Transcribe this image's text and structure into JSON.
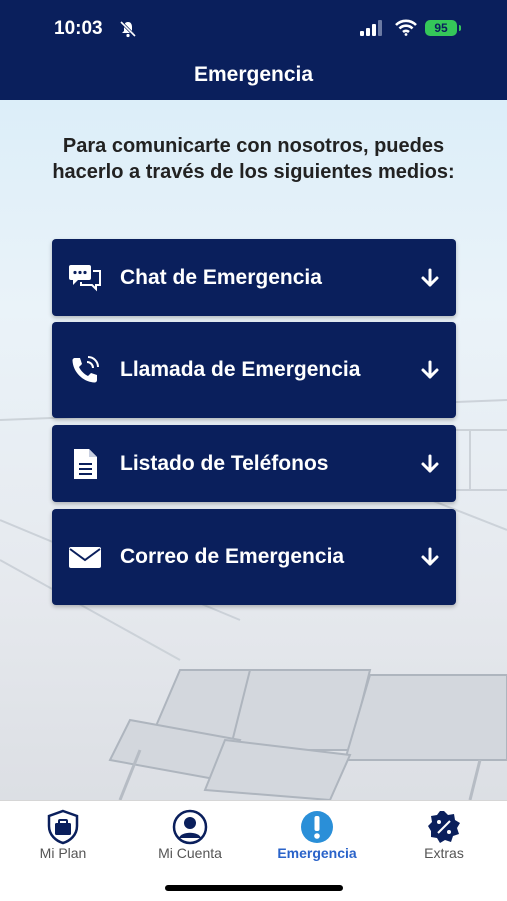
{
  "status_bar": {
    "time": "10:03",
    "battery": "95"
  },
  "header": {
    "title": "Emergencia"
  },
  "intro_text": "Para comunicarte con nosotros, puedes hacerlo a través de los siguientes medios:",
  "options": [
    {
      "label": "Chat de Emergencia",
      "icon": "chat-icon"
    },
    {
      "label": "Llamada de Emergencia",
      "icon": "phone-icon"
    },
    {
      "label": "Listado de Teléfonos",
      "icon": "document-icon"
    },
    {
      "label": "Correo de Emergencia",
      "icon": "envelope-icon"
    }
  ],
  "tabs": [
    {
      "label": "Mi Plan",
      "icon": "briefcase-shield-icon"
    },
    {
      "label": "Mi Cuenta",
      "icon": "user-icon"
    },
    {
      "label": "Emergencia",
      "icon": "exclamation-icon",
      "active": true
    },
    {
      "label": "Extras",
      "icon": "percent-badge-icon"
    }
  ],
  "colors": {
    "navy": "#0a1f5c",
    "active_tab": "#2a63c9",
    "battery": "#35c759"
  }
}
